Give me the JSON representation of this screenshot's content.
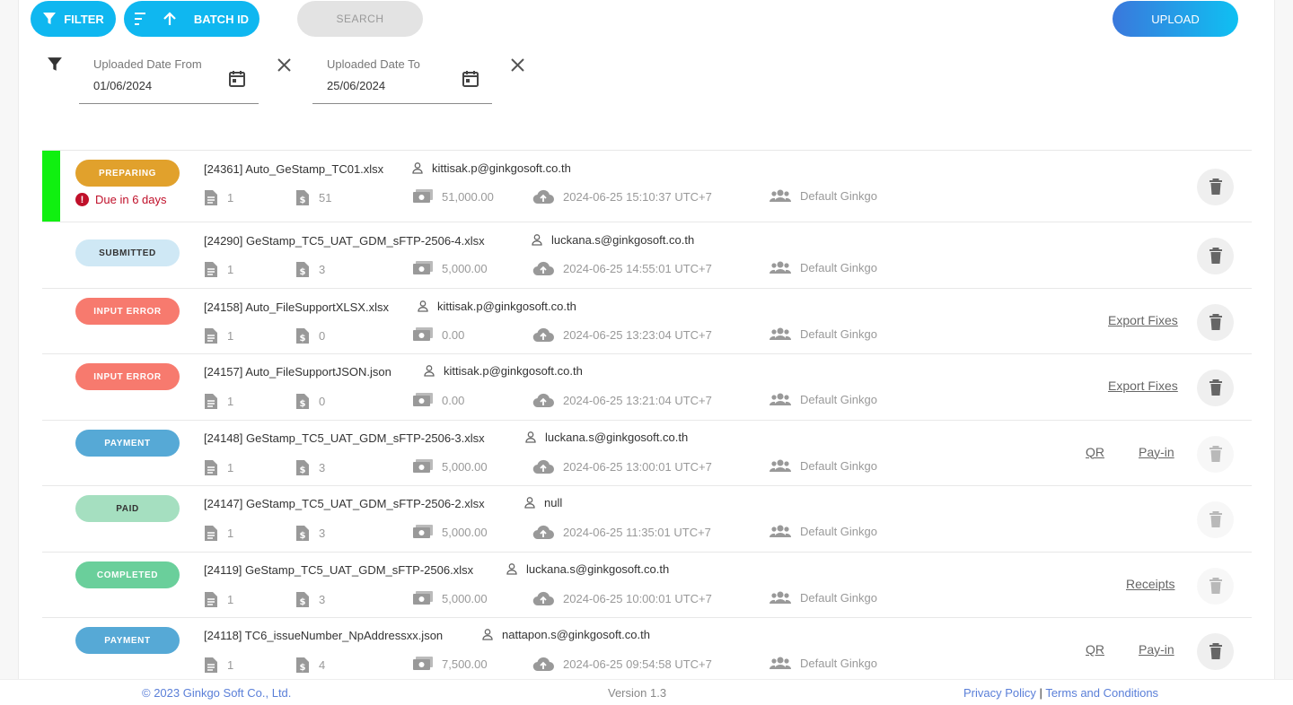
{
  "toolbar": {
    "filter_label": "FILTER",
    "batch_label": "BATCH ID",
    "search_placeholder": "SEARCH",
    "upload_label": "UPLOAD"
  },
  "filters": {
    "date_from": {
      "label": "Uploaded Date From",
      "value": "01/06/2024"
    },
    "date_to": {
      "label": "Uploaded Date To",
      "value": "25/06/2024"
    }
  },
  "colors": {
    "accent": "#0fb7f0",
    "marker": "#10f010",
    "due": "#c0102a"
  },
  "batches": [
    {
      "status": "PREPARING",
      "status_bg": "#e1a12c",
      "status_fg": "#ffffff",
      "due": "Due in 6 days",
      "marker": true,
      "file": "[24361] Auto_GeStamp_TC01.xlsx",
      "user": "kittisak.p@ginkgosoft.co.th",
      "docs": "1",
      "stamps": "51",
      "amount": "51,000.00",
      "uploaded": "2024-06-25 15:10:37 UTC+7",
      "group": "Default Ginkgo",
      "actions": [],
      "trash_enabled": true
    },
    {
      "status": "SUBMITTED",
      "status_bg": "#cfe8f5",
      "status_fg": "#333333",
      "file": "[24290] GeStamp_TC5_UAT_GDM_sFTP-2506-4.xlsx",
      "user": "luckana.s@ginkgosoft.co.th",
      "docs": "1",
      "stamps": "3",
      "amount": "5,000.00",
      "uploaded": "2024-06-25 14:55:01 UTC+7",
      "group": "Default Ginkgo",
      "actions": [],
      "trash_enabled": true
    },
    {
      "status": "INPUT ERROR",
      "status_bg": "#f77a6e",
      "status_fg": "#ffffff",
      "file": "[24158] Auto_FileSupportXLSX.xlsx",
      "user": "kittisak.p@ginkgosoft.co.th",
      "docs": "1",
      "stamps": "0",
      "amount": "0.00",
      "uploaded": "2024-06-25 13:23:04 UTC+7",
      "group": "Default Ginkgo",
      "actions": [
        "Export Fixes"
      ],
      "trash_enabled": true
    },
    {
      "status": "INPUT ERROR",
      "status_bg": "#f77a6e",
      "status_fg": "#ffffff",
      "file": "[24157] Auto_FileSupportJSON.json",
      "user": "kittisak.p@ginkgosoft.co.th",
      "docs": "1",
      "stamps": "0",
      "amount": "0.00",
      "uploaded": "2024-06-25 13:21:04 UTC+7",
      "group": "Default Ginkgo",
      "actions": [
        "Export Fixes"
      ],
      "trash_enabled": true
    },
    {
      "status": "PAYMENT",
      "status_bg": "#56a9d6",
      "status_fg": "#ffffff",
      "file": "[24148] GeStamp_TC5_UAT_GDM_sFTP-2506-3.xlsx",
      "user": "luckana.s@ginkgosoft.co.th",
      "docs": "1",
      "stamps": "3",
      "amount": "5,000.00",
      "uploaded": "2024-06-25 13:00:01 UTC+7",
      "group": "Default Ginkgo",
      "actions": [
        "QR",
        "Pay-in"
      ],
      "trash_enabled": false
    },
    {
      "status": "PAID",
      "status_bg": "#a5dfc0",
      "status_fg": "#333333",
      "file": "[24147] GeStamp_TC5_UAT_GDM_sFTP-2506-2.xlsx",
      "user": "null",
      "docs": "1",
      "stamps": "3",
      "amount": "5,000.00",
      "uploaded": "2024-06-25 11:35:01 UTC+7",
      "group": "Default Ginkgo",
      "actions": [],
      "trash_enabled": false
    },
    {
      "status": "COMPLETED",
      "status_bg": "#6acf9b",
      "status_fg": "#ffffff",
      "file": "[24119] GeStamp_TC5_UAT_GDM_sFTP-2506.xlsx",
      "user": "luckana.s@ginkgosoft.co.th",
      "docs": "1",
      "stamps": "3",
      "amount": "5,000.00",
      "uploaded": "2024-06-25 10:00:01 UTC+7",
      "group": "Default Ginkgo",
      "actions": [
        "Receipts"
      ],
      "trash_enabled": false
    },
    {
      "status": "PAYMENT",
      "status_bg": "#56a9d6",
      "status_fg": "#ffffff",
      "file": "[24118] TC6_issueNumber_NpAddressxx.json",
      "user": "nattapon.s@ginkgosoft.co.th",
      "docs": "1",
      "stamps": "4",
      "amount": "7,500.00",
      "uploaded": "2024-06-25 09:54:58 UTC+7",
      "group": "Default Ginkgo",
      "actions": [
        "QR",
        "Pay-in"
      ],
      "trash_enabled": true
    }
  ],
  "footer": {
    "copyright": "© 2023 Ginkgo Soft Co., Ltd.",
    "version": "Version 1.3",
    "privacy": "Privacy Policy",
    "separator": "|",
    "terms": "Terms and Conditions"
  }
}
